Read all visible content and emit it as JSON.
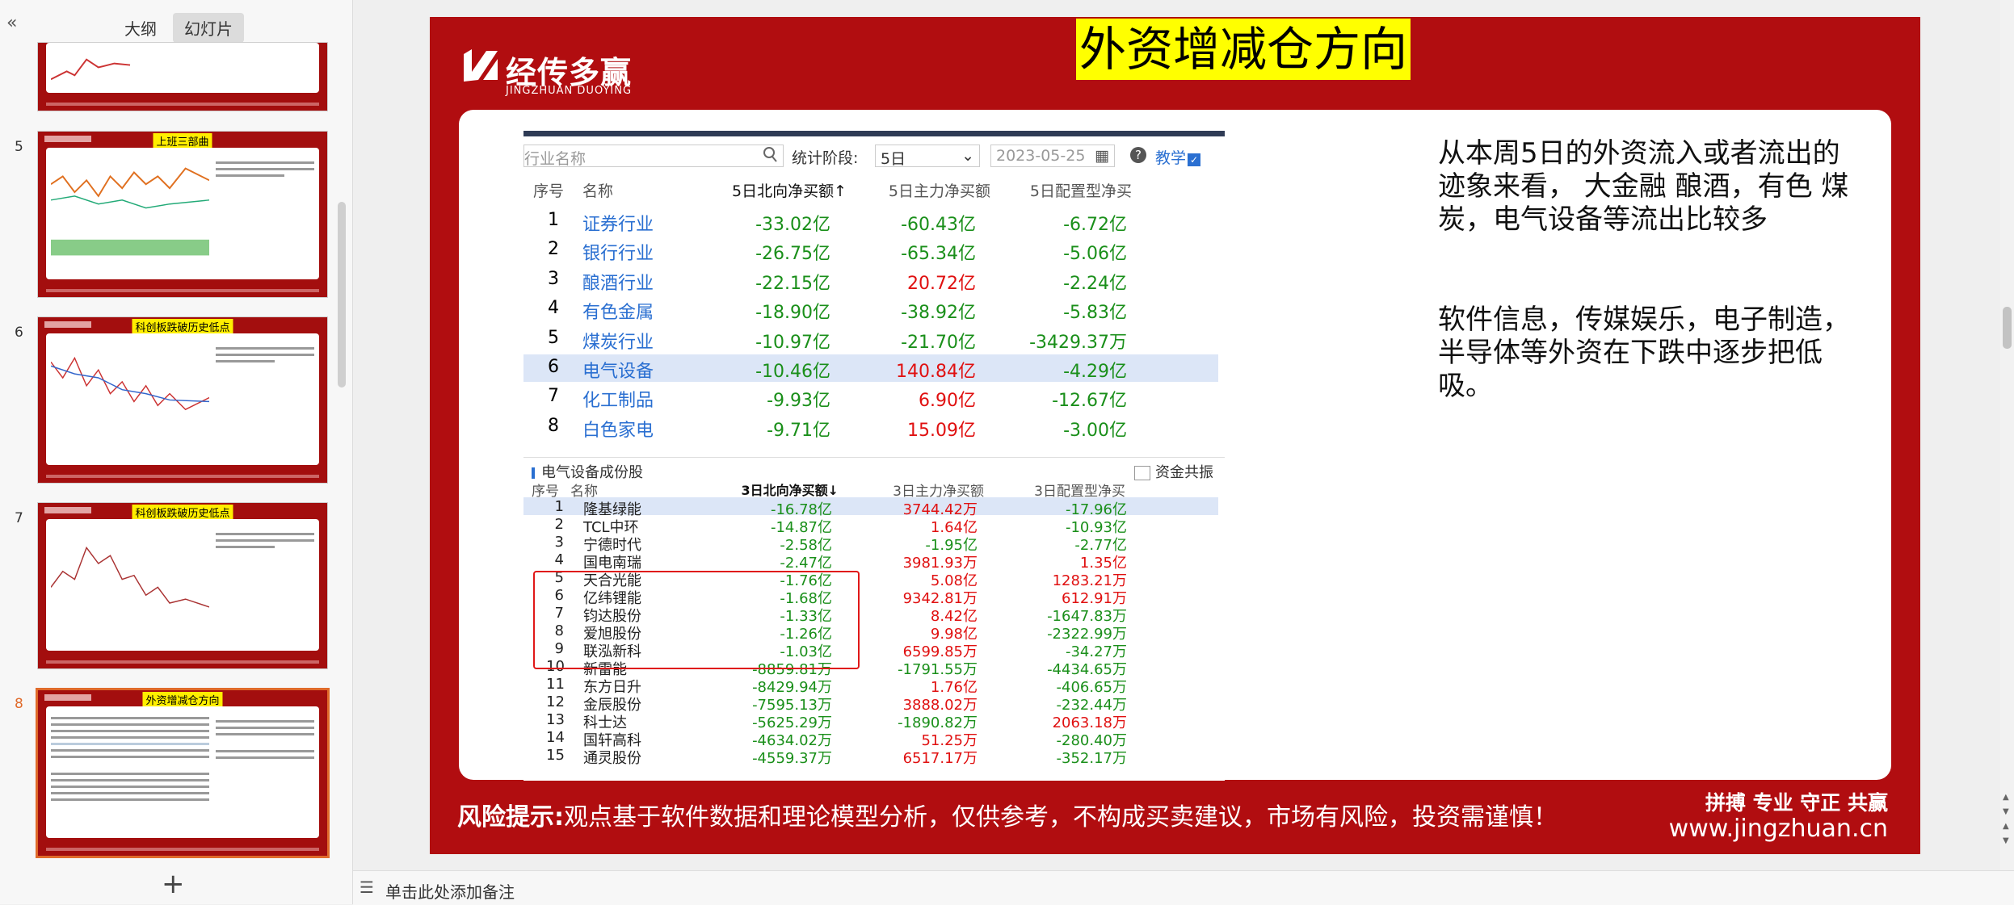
{
  "sidebar": {
    "collapse_icon": "«",
    "tabs": [
      "大纲",
      "幻灯片"
    ],
    "thumbnails": [
      {
        "num": "",
        "title": ""
      },
      {
        "num": "5",
        "title": "上班三部曲"
      },
      {
        "num": "6",
        "title": "科创板跌破历史低点"
      },
      {
        "num": "7",
        "title": "科创板跌破历史低点"
      },
      {
        "num": "8",
        "title": "外资增减仓方向"
      }
    ],
    "add_icon": "+"
  },
  "slide": {
    "title": "外资增减仓方向",
    "logo_cn": "经传多赢",
    "logo_en": "JINGZHUAN DUOYING",
    "screenshot1": {
      "search_placeholder": "行业名称",
      "stat_label": "统计阶段:",
      "period": "5日",
      "date": "2023-05-25",
      "help": "?",
      "teach": "教学",
      "headers": [
        "序号",
        "名称",
        "5日北向净买额↑",
        "5日主力净买额",
        "5日配置型净买"
      ],
      "rows": [
        {
          "idx": "1",
          "name": "证券行业",
          "v1": "-33.02亿",
          "v2": "-60.43亿",
          "v3": "-6.72亿"
        },
        {
          "idx": "2",
          "name": "银行行业",
          "v1": "-26.75亿",
          "v2": "-65.34亿",
          "v3": "-5.06亿"
        },
        {
          "idx": "3",
          "name": "酿酒行业",
          "v1": "-22.15亿",
          "v2": "20.72亿",
          "v3": "-2.24亿"
        },
        {
          "idx": "4",
          "name": "有色金属",
          "v1": "-18.90亿",
          "v2": "-38.92亿",
          "v3": "-5.83亿"
        },
        {
          "idx": "5",
          "name": "煤炭行业",
          "v1": "-10.97亿",
          "v2": "-21.70亿",
          "v3": "-3429.37万"
        },
        {
          "idx": "6",
          "name": "电气设备",
          "v1": "-10.46亿",
          "v2": "140.84亿",
          "v3": "-4.29亿"
        },
        {
          "idx": "7",
          "name": "化工制品",
          "v1": "-9.93亿",
          "v2": "6.90亿",
          "v3": "-12.67亿"
        },
        {
          "idx": "8",
          "name": "白色家电",
          "v1": "-9.71亿",
          "v2": "15.09亿",
          "v3": "-3.00亿"
        }
      ]
    },
    "screenshot2": {
      "title": "电气设备成份股",
      "check_label": "资金共振",
      "headers": [
        "序号",
        "名称",
        "3日北向净买额↓",
        "3日主力净买额",
        "3日配置型净买"
      ],
      "rows": [
        {
          "idx": "1",
          "name": "隆基绿能",
          "v1": "-16.78亿",
          "v2": "3744.42万",
          "v3": "-17.96亿"
        },
        {
          "idx": "2",
          "name": "TCL中环",
          "v1": "-14.87亿",
          "v2": "1.64亿",
          "v3": "-10.93亿"
        },
        {
          "idx": "3",
          "name": "宁德时代",
          "v1": "-2.58亿",
          "v2": "-1.95亿",
          "v3": "-2.77亿"
        },
        {
          "idx": "4",
          "name": "国电南瑞",
          "v1": "-2.47亿",
          "v2": "3981.93万",
          "v3": "1.35亿"
        },
        {
          "idx": "5",
          "name": "天合光能",
          "v1": "-1.76亿",
          "v2": "5.08亿",
          "v3": "1283.21万"
        },
        {
          "idx": "6",
          "name": "亿纬锂能",
          "v1": "-1.68亿",
          "v2": "9342.81万",
          "v3": "612.91万"
        },
        {
          "idx": "7",
          "name": "钧达股份",
          "v1": "-1.33亿",
          "v2": "8.42亿",
          "v3": "-1647.83万"
        },
        {
          "idx": "8",
          "name": "爱旭股份",
          "v1": "-1.26亿",
          "v2": "9.98亿",
          "v3": "-2322.99万"
        },
        {
          "idx": "9",
          "name": "联泓新科",
          "v1": "-1.03亿",
          "v2": "6599.85万",
          "v3": "-34.27万"
        },
        {
          "idx": "10",
          "name": "新雷能",
          "v1": "-8859.81万",
          "v2": "-1791.55万",
          "v3": "-4434.65万"
        },
        {
          "idx": "11",
          "name": "东方日升",
          "v1": "-8429.94万",
          "v2": "1.76亿",
          "v3": "-406.65万"
        },
        {
          "idx": "12",
          "name": "金辰股份",
          "v1": "-7595.13万",
          "v2": "3888.02万",
          "v3": "-232.44万"
        },
        {
          "idx": "13",
          "name": "科士达",
          "v1": "-5625.29万",
          "v2": "-1890.82万",
          "v3": "2063.18万"
        },
        {
          "idx": "14",
          "name": "国轩高科",
          "v1": "-4634.02万",
          "v2": "51.25万",
          "v3": "-280.40万"
        },
        {
          "idx": "15",
          "name": "通灵股份",
          "v1": "-4559.37万",
          "v2": "6517.17万",
          "v3": "-352.17万"
        }
      ]
    },
    "paragraph1": "从本周5日的外资流入或者流出的迹象来看， 大金融 酿酒，有色 煤炭，电气设备等流出比较多",
    "paragraph2": "软件信息，传媒娱乐，电子制造，半导体等外资在下跌中逐步把低吸。",
    "risk_label": "风险提示:",
    "risk_text": "观点基于软件数据和理论模型分析，仅供参考，不构成买卖建议，市场有风险，投资需谨慎！",
    "slogan": "拼搏 专业 守正 共赢",
    "website": "www.jingzhuan.cn"
  },
  "notes": {
    "placeholder": "单击此处添加备注"
  },
  "colors": {
    "slide_bg": "#b10d10",
    "title_bg": "#ffff00",
    "negative": "#1a8f1a",
    "positive": "#e01010",
    "highlight_row": "#dce6f7",
    "selected_thumb": "#e06a2a"
  }
}
